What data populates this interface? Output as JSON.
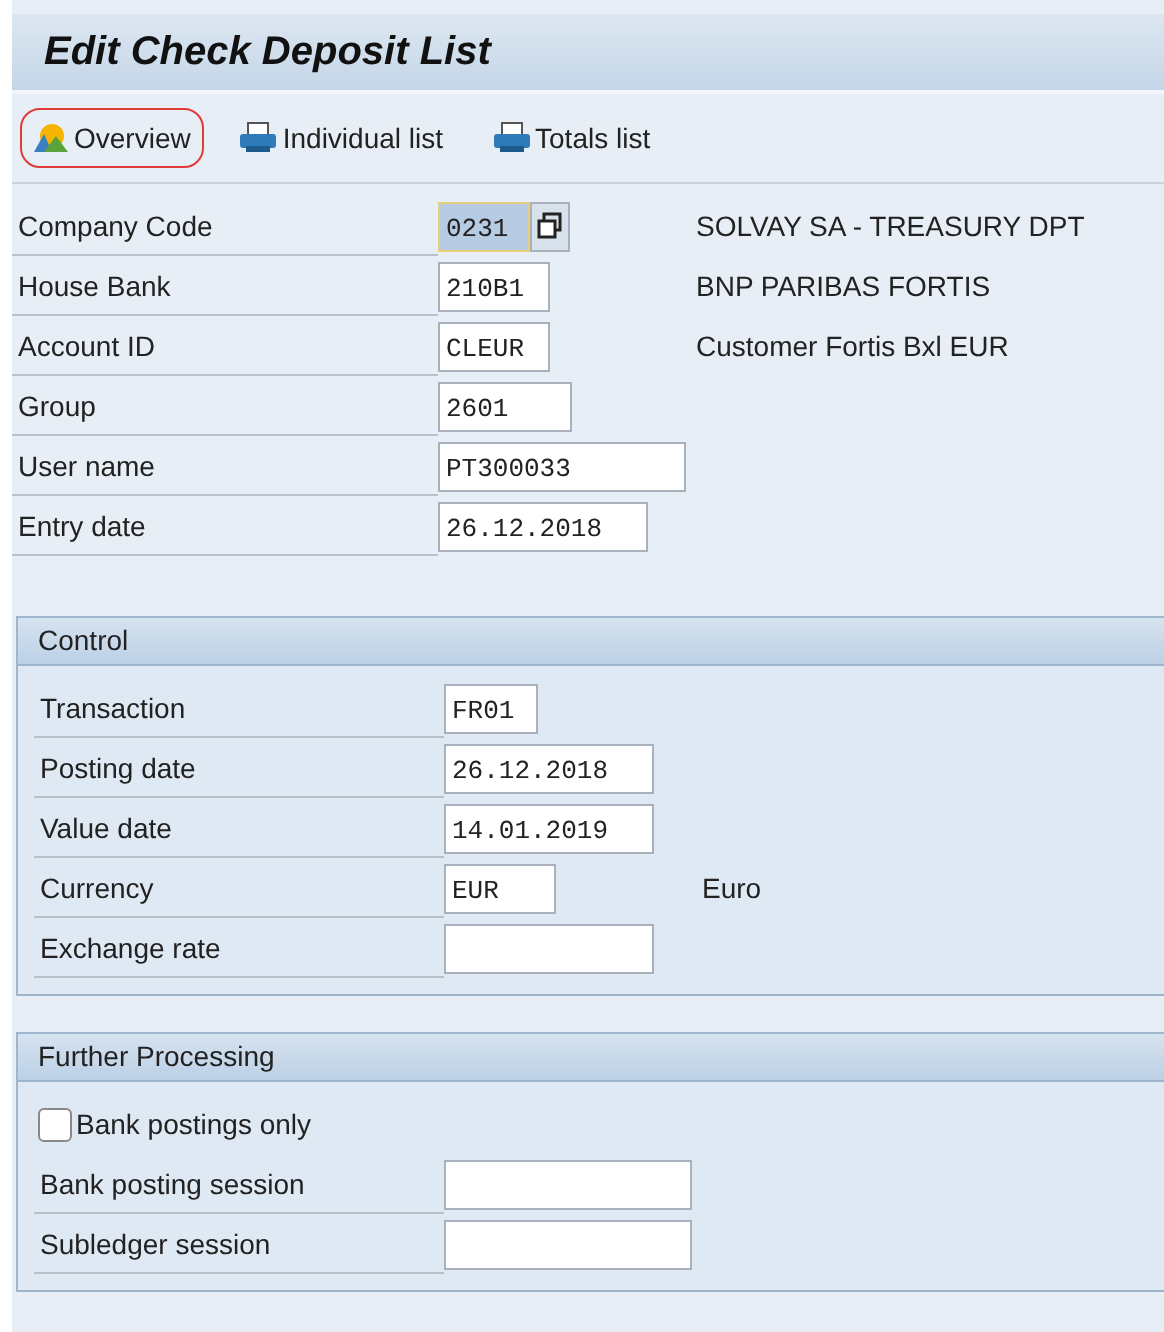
{
  "window": {
    "title": "Edit Check Deposit List"
  },
  "toolbar": [
    {
      "label": "Overview",
      "kind": "overview",
      "highlighted": true
    },
    {
      "label": "Individual list",
      "kind": "print",
      "highlighted": false
    },
    {
      "label": "Totals list",
      "kind": "print",
      "highlighted": false
    }
  ],
  "header_fields": [
    {
      "label": "Company Code",
      "value": "0231",
      "focused": true,
      "help_button": true,
      "description": "SOLVAY SA - TREASURY DPT"
    },
    {
      "label": "House Bank",
      "value": "210B1",
      "focused": false,
      "help_button": false,
      "description": "BNP PARIBAS FORTIS"
    },
    {
      "label": "Account ID",
      "value": "CLEUR",
      "focused": false,
      "help_button": false,
      "description": "Customer Fortis Bxl EUR"
    },
    {
      "label": "Group",
      "value": "2601",
      "focused": false,
      "help_button": false
    },
    {
      "label": "User name",
      "value": "PT300033",
      "focused": false,
      "help_button": false
    },
    {
      "label": "Entry date",
      "value": "26.12.2018",
      "focused": false,
      "help_button": false
    }
  ],
  "groups": [
    {
      "title": "Control",
      "rows": [
        {
          "kind": "field",
          "label": "Transaction",
          "value": "FR01"
        },
        {
          "kind": "field",
          "label": "Posting date",
          "value": "26.12.2018"
        },
        {
          "kind": "field",
          "label": "Value date",
          "value": "14.01.2019"
        },
        {
          "kind": "field",
          "label": "Currency",
          "value": "EUR",
          "description": "Euro"
        },
        {
          "kind": "field",
          "label": "Exchange rate"
        }
      ]
    },
    {
      "title": "Further Processing",
      "rows": [
        {
          "kind": "checkbox",
          "label": "Bank postings only",
          "checked": false
        },
        {
          "kind": "field",
          "label": "Bank posting session"
        },
        {
          "kind": "field",
          "label": "Subledger session"
        }
      ]
    }
  ]
}
